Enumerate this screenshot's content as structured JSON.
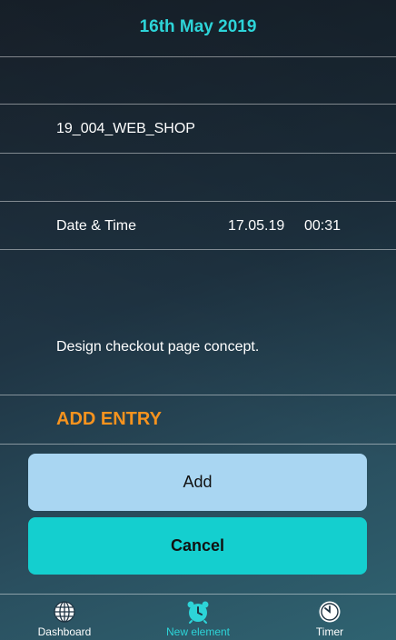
{
  "header": {
    "date_title": "16th May 2019"
  },
  "form": {
    "project_code": "19_004_WEB_SHOP",
    "datetime_label": "Date & Time",
    "date_value": "17.05.19",
    "time_value": "00:31",
    "description": "Design checkout page concept."
  },
  "section": {
    "title": "ADD ENTRY"
  },
  "buttons": {
    "add_label": "Add",
    "cancel_label": "Cancel"
  },
  "nav": {
    "items": [
      {
        "label": "Dashboard",
        "icon": "globe-icon",
        "active": false
      },
      {
        "label": "New element",
        "icon": "alarm-clock-icon",
        "active": true
      },
      {
        "label": "Timer",
        "icon": "clock-icon",
        "active": false
      }
    ]
  },
  "colors": {
    "accent": "#2dd4d8",
    "section_title": "#f7931e",
    "add_button": "#a9d6f2",
    "cancel_button": "#14cfcf"
  }
}
